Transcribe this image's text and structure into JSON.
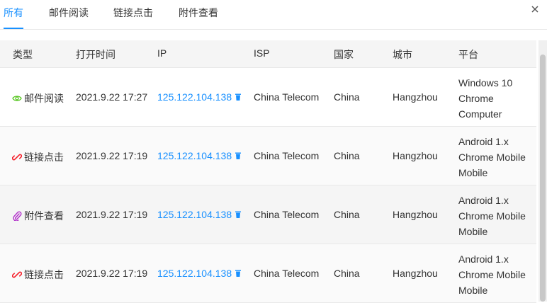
{
  "tabs": [
    {
      "label": "所有",
      "active": true
    },
    {
      "label": "邮件阅读",
      "active": false
    },
    {
      "label": "链接点击",
      "active": false
    },
    {
      "label": "附件查看",
      "active": false
    }
  ],
  "columns": [
    "类型",
    "打开时间",
    "IP",
    "ISP",
    "国家",
    "城市",
    "平台"
  ],
  "rows": [
    {
      "type": "邮件阅读",
      "icon": "eye-icon",
      "time": "2021.9.22 17:27",
      "ip": "125.122.104.138",
      "isp": "China Telecom",
      "country": "China",
      "city": "Hangzhou",
      "platform": [
        "Windows 10",
        "Chrome",
        "Computer"
      ]
    },
    {
      "type": "链接点击",
      "icon": "link-icon",
      "time": "2021.9.22 17:19",
      "ip": "125.122.104.138",
      "isp": "China Telecom",
      "country": "China",
      "city": "Hangzhou",
      "platform": [
        "Android 1.x",
        "Chrome Mobile",
        "Mobile"
      ]
    },
    {
      "type": "附件查看",
      "icon": "paperclip-icon",
      "time": "2021.9.22 17:19",
      "ip": "125.122.104.138",
      "isp": "China Telecom",
      "country": "China",
      "city": "Hangzhou",
      "platform": [
        "Android 1.x",
        "Chrome Mobile",
        "Mobile"
      ]
    },
    {
      "type": "链接点击",
      "icon": "link-icon",
      "time": "2021.9.22 17:19",
      "ip": "125.122.104.138",
      "isp": "China Telecom",
      "country": "China",
      "city": "Hangzhou",
      "platform": [
        "Android 1.x",
        "Chrome Mobile",
        "Mobile"
      ]
    }
  ],
  "colors": {
    "accent": "#1890ff",
    "eye": "#52c41a",
    "link": "#f5222d",
    "clip": "#b02ec9"
  }
}
